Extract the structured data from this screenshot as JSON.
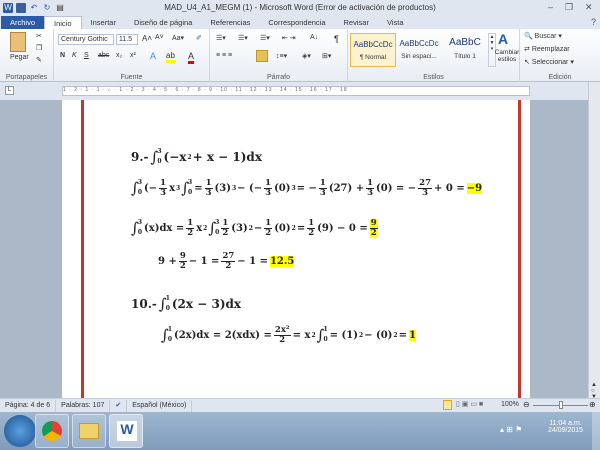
{
  "window": {
    "title": "MAD_U4_A1_MEGM (1)  -  Microsoft Word (Error de activación de productos)",
    "minimize": "–",
    "restore": "❐",
    "close": "✕"
  },
  "tabs": [
    "Archivo",
    "Inicio",
    "Insertar",
    "Diseño de página",
    "Referencias",
    "Correspondencia",
    "Revisar",
    "Vista"
  ],
  "ribbon": {
    "clipboard": {
      "label": "Portapapeles",
      "paste": "Pegar"
    },
    "font": {
      "label": "Fuente",
      "family": "Century Gothic",
      "size": "11.5",
      "bold": "N",
      "italic": "K",
      "underline": "S",
      "strike": "abc",
      "sub": "x₂",
      "sup": "x²"
    },
    "paragraph": {
      "label": "Párrafo",
      "pilcrow": "¶"
    },
    "styles": {
      "label": "Estilos",
      "items": [
        {
          "preview": "AaBbCcDc",
          "name": "¶ Normal"
        },
        {
          "preview": "AaBbCcDc",
          "name": "Sin espaci..."
        },
        {
          "preview": "AaBbC",
          "name": "Título 1"
        }
      ],
      "change": "Cambiar estilos"
    },
    "editing": {
      "label": "Edición",
      "find": "Buscar",
      "replace": "Reemplazar",
      "select": "Seleccionar"
    }
  },
  "ruler": "1 · 2 · 1 · 1 · ⌂ · 1 · 2 · 3 · 4 · 5 · 6 · 7 · 8 · 9 · 10 · 11 · 12 · 13 · 14 · 15 · 16 · 17 · 18",
  "document": {
    "lines": [
      [
        [
          "t",
          "9.-"
        ],
        [
          "i",
          "0",
          "3"
        ],
        [
          "t",
          "(−x"
        ],
        [
          "s",
          "2"
        ],
        [
          "t",
          " + x − 1)dx"
        ]
      ],
      [
        [
          "i",
          "0",
          "3"
        ],
        [
          "t",
          "(−"
        ],
        [
          "f",
          "1",
          "3"
        ],
        [
          "t",
          "x"
        ],
        [
          "s",
          "3"
        ],
        [
          "i",
          "0",
          "3"
        ],
        [
          "t",
          " = "
        ],
        [
          "f",
          "1",
          "3"
        ],
        [
          "t",
          "(3)"
        ],
        [
          "s",
          "3"
        ],
        [
          "t",
          " − (−"
        ],
        [
          "f",
          "1",
          "3"
        ],
        [
          "t",
          "(0)"
        ],
        [
          "s",
          "3"
        ],
        [
          "t",
          " = −"
        ],
        [
          "f",
          "1",
          "3"
        ],
        [
          "t",
          "(27) + "
        ],
        [
          "f",
          "1",
          "3"
        ],
        [
          "t",
          "(0) = −"
        ],
        [
          "f",
          "27",
          "3"
        ],
        [
          "t",
          " + 0 = "
        ],
        [
          "h",
          "−9"
        ]
      ],
      [
        [
          "i",
          "0",
          "3"
        ],
        [
          "t",
          "(x)dx = "
        ],
        [
          "f",
          "1",
          "2"
        ],
        [
          "t",
          "x"
        ],
        [
          "s",
          "2"
        ],
        [
          "i",
          "0",
          "3"
        ],
        [
          "f",
          "1",
          "2"
        ],
        [
          "t",
          "(3)"
        ],
        [
          "s",
          "2"
        ],
        [
          "t",
          " − "
        ],
        [
          "f",
          "1",
          "2"
        ],
        [
          "t",
          "(0)"
        ],
        [
          "s",
          "2"
        ],
        [
          "t",
          " = "
        ],
        [
          "f",
          "1",
          "2"
        ],
        [
          "t",
          "(9) − 0 = "
        ],
        [
          "hf",
          "9",
          "2"
        ]
      ],
      [
        [
          "t",
          "9 + "
        ],
        [
          "f",
          "9",
          "2"
        ],
        [
          "t",
          " − 1 = "
        ],
        [
          "f",
          "27",
          "2"
        ],
        [
          "t",
          " − 1 = "
        ],
        [
          "h",
          "12.5"
        ]
      ],
      [
        [
          "t",
          "10.-"
        ],
        [
          "i",
          "0",
          "1"
        ],
        [
          "t",
          "(2x − 3)dx"
        ]
      ],
      [
        [
          "i",
          "0",
          "1"
        ],
        [
          "t",
          "(2x)dx = 2(xdx) = "
        ],
        [
          "f",
          "2x²",
          "2"
        ],
        [
          "t",
          " = x"
        ],
        [
          "s",
          "2"
        ],
        [
          "i",
          "0",
          "1"
        ],
        [
          "t",
          " = (1)"
        ],
        [
          "s",
          "2"
        ],
        [
          "t",
          " − (0)"
        ],
        [
          "s",
          "2"
        ],
        [
          "t",
          " = "
        ],
        [
          "h",
          "1"
        ]
      ]
    ]
  },
  "status": {
    "page": "Página: 4 de 6",
    "words": "Palabras: 107",
    "language": "Español (México)",
    "zoom": "100%",
    "zoom_level": 100
  },
  "taskbar": {
    "time": "11:04 a.m.",
    "date": "24/09/2015"
  },
  "colors": {
    "accent": "#2a5aa8",
    "margin_line": "#c0392b",
    "highlight": "#ffff00"
  }
}
